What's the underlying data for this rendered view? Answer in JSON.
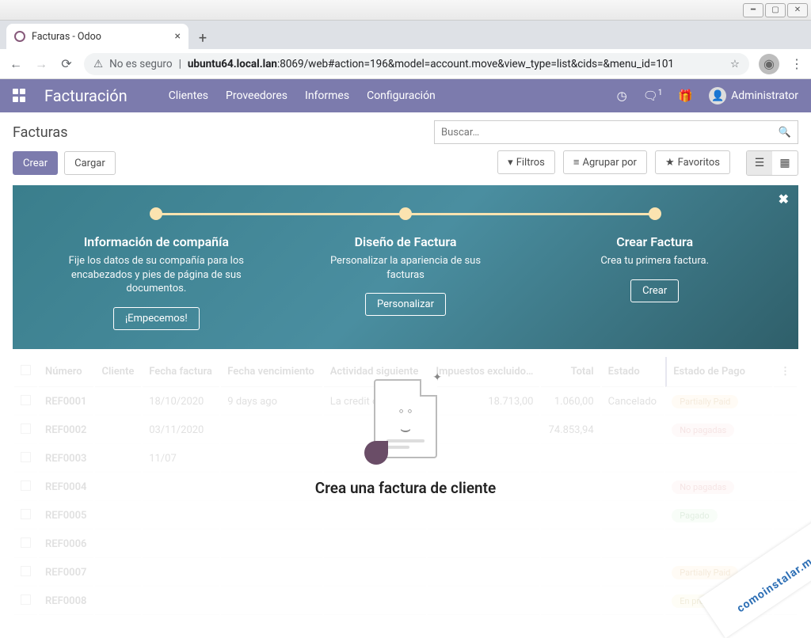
{
  "browser": {
    "tab_title": "Facturas - Odoo",
    "url_prefix": "No es seguro",
    "url_host": "ubuntu64.local.lan",
    "url_path": ":8069/web#action=196&model=account.move&view_type=list&cids=&menu_id=101"
  },
  "odoo_nav": {
    "module": "Facturación",
    "links": [
      "Clientes",
      "Proveedores",
      "Informes",
      "Configuración"
    ],
    "msg_badge": "1",
    "user": "Administrator"
  },
  "cp": {
    "title": "Facturas",
    "search_placeholder": "Buscar…",
    "btn_crear": "Crear",
    "btn_cargar": "Cargar",
    "btn_filtros": "Filtros",
    "btn_agrupar": "Agrupar por",
    "btn_favoritos": "Favoritos"
  },
  "onboard": {
    "steps": [
      {
        "title": "Información de compañía",
        "desc": "Fije los datos de su compañía para los encabezados y pies de página de sus documentos.",
        "btn": "¡Empecemos!"
      },
      {
        "title": "Diseño de Factura",
        "desc": "Personalizar la apariencia de sus facturas",
        "btn": "Personalizar"
      },
      {
        "title": "Crear Factura",
        "desc": "Crea tu primera factura.",
        "btn": "Crear"
      }
    ]
  },
  "table": {
    "cols": [
      "Número",
      "Cliente",
      "Fecha factura",
      "Fecha vencimiento",
      "Actividad siguiente",
      "Impuestos excluido…",
      "Total",
      "Estado",
      "Estado de Pago"
    ],
    "rows": [
      {
        "ref": "REF0001",
        "date": "18/10/2020",
        "due": "9 days ago",
        "act": "La credit o",
        "tax": "18.713,00",
        "total": "1.060,00",
        "state": "Cancelado",
        "pago": "Partially Paid",
        "pill": "pill-orange"
      },
      {
        "ref": "REF0002",
        "date": "03/11/2020",
        "due": "",
        "act": "",
        "tax": "",
        "total": "74.853,94",
        "state": "",
        "pago": "No pagadas",
        "pill": "pill-red"
      },
      {
        "ref": "REF0003",
        "date": "11/07",
        "due": "",
        "act": "",
        "tax": "",
        "total": "",
        "state": "",
        "pago": "",
        "pill": ""
      },
      {
        "ref": "REF0004",
        "date": "",
        "due": "",
        "act": "",
        "tax": "",
        "total": "",
        "state": "",
        "pago": "No pagadas",
        "pill": "pill-red"
      },
      {
        "ref": "REF0005",
        "date": "",
        "due": "",
        "act": "",
        "tax": "",
        "total": "",
        "state": "",
        "pago": "Pagado",
        "pill": "pill-green"
      },
      {
        "ref": "REF0006",
        "date": "",
        "due": "",
        "act": "",
        "tax": "",
        "total": "",
        "state": "",
        "pago": "",
        "pill": ""
      },
      {
        "ref": "REF0007",
        "date": "",
        "due": "",
        "act": "",
        "tax": "",
        "total": "",
        "state": "",
        "pago": "Partially Paid",
        "pill": "pill-orange"
      },
      {
        "ref": "REF0008",
        "date": "",
        "due": "",
        "act": "",
        "tax": "",
        "total": "",
        "state": "",
        "pago": "En proceso de pago",
        "pill": "pill-yellow"
      }
    ]
  },
  "empty": {
    "title": "Crea una factura de cliente"
  },
  "watermark": "comoinstalar.me"
}
